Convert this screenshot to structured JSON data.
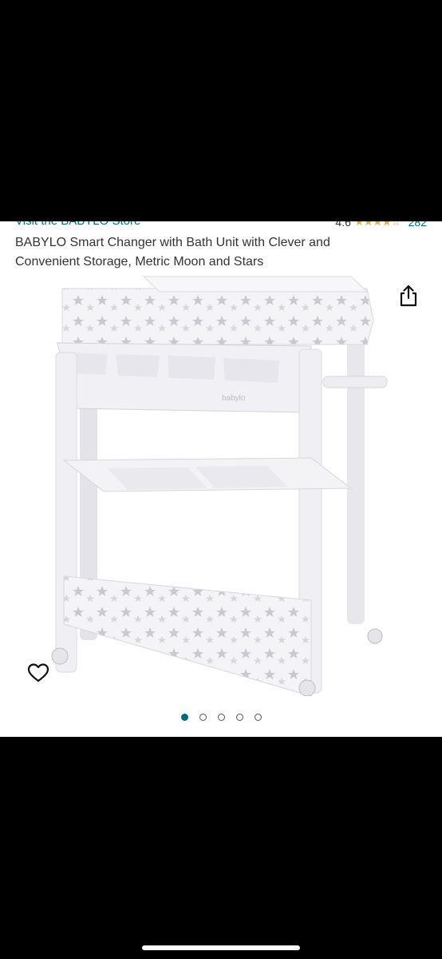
{
  "product": {
    "store_link": "Visit the BABYLO Store",
    "rating_value": "4.6",
    "stars_display": "★★★★☆",
    "rating_count": "282",
    "title": "BABYLO Smart Changer with Bath Unit with Clever and Convenient Storage, Metric Moon and Stars"
  },
  "icons": {
    "share": "share-icon",
    "favorite": "heart-icon"
  },
  "carousel": {
    "total": 5,
    "active_index": 0
  },
  "colors": {
    "link": "#007185",
    "star": "#f5a623",
    "active_dot": "#006b7a"
  }
}
